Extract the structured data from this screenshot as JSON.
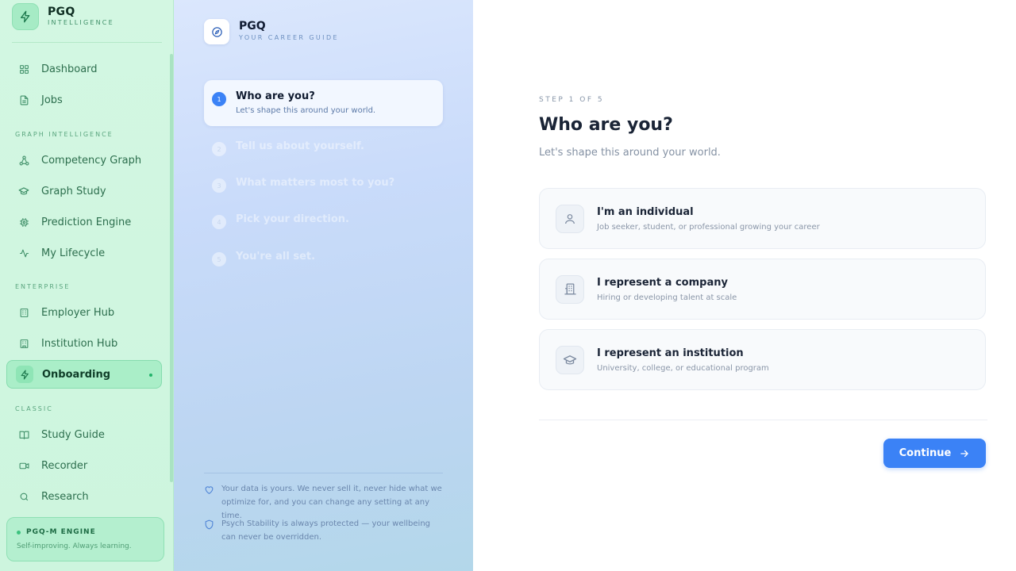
{
  "sidebar": {
    "brand_name": "PGQ",
    "brand_sub": "INTELLIGENCE",
    "items_top": [
      {
        "label": "Dashboard",
        "icon": "grid-icon"
      },
      {
        "label": "Jobs",
        "icon": "document-icon"
      }
    ],
    "section_graph": "GRAPH INTELLIGENCE",
    "items_graph": [
      {
        "label": "Competency Graph",
        "icon": "graph-nodes-icon"
      },
      {
        "label": "Graph Study",
        "icon": "graduation-cap-icon"
      },
      {
        "label": "Prediction Engine",
        "icon": "chip-icon"
      },
      {
        "label": "My Lifecycle",
        "icon": "activity-icon"
      }
    ],
    "section_enterprise": "ENTERPRISE",
    "items_enterprise": [
      {
        "label": "Employer Hub",
        "icon": "building-icon"
      },
      {
        "label": "Institution Hub",
        "icon": "institution-icon"
      },
      {
        "label": "Onboarding",
        "icon": "lightning-icon",
        "active": true
      }
    ],
    "section_classic": "CLASSIC",
    "items_classic": [
      {
        "label": "Study Guide",
        "icon": "book-icon"
      },
      {
        "label": "Recorder",
        "icon": "video-icon"
      },
      {
        "label": "Research",
        "icon": "search-icon"
      }
    ],
    "engine": {
      "title": "PGQ-M ENGINE",
      "subtitle": "Self-improving. Always learning."
    }
  },
  "guide": {
    "brand_name": "PGQ",
    "brand_sub": "YOUR CAREER GUIDE",
    "steps": [
      {
        "num": "1",
        "title": "Who are you?",
        "desc": "Let's shape this around your world.",
        "active": true
      },
      {
        "num": "2",
        "title": "Tell us about yourself."
      },
      {
        "num": "3",
        "title": "What matters most to you?"
      },
      {
        "num": "4",
        "title": "Pick your direction."
      },
      {
        "num": "5",
        "title": "You're all set."
      }
    ],
    "notes": [
      "Your data is yours. We never sell it, never hide what we optimize for, and you can change any setting at any time.",
      "Psych Stability is always protected — your wellbeing can never be overridden."
    ]
  },
  "main": {
    "step_label": "STEP 1 OF 5",
    "title": "Who are you?",
    "subtitle": "Let's shape this around your world.",
    "options": [
      {
        "title": "I'm an individual",
        "desc": "Job seeker, student, or professional growing your career",
        "icon": "person-icon"
      },
      {
        "title": "I represent a company",
        "desc": "Hiring or developing talent at scale",
        "icon": "building-icon"
      },
      {
        "title": "I represent an institution",
        "desc": "University, college, or educational program",
        "icon": "graduation-cap-icon"
      }
    ],
    "continue_label": "Continue"
  },
  "colors": {
    "accent": "#3b82f6",
    "sidebar_bg": "#d3f7e2",
    "active_green": "#22b36a"
  }
}
